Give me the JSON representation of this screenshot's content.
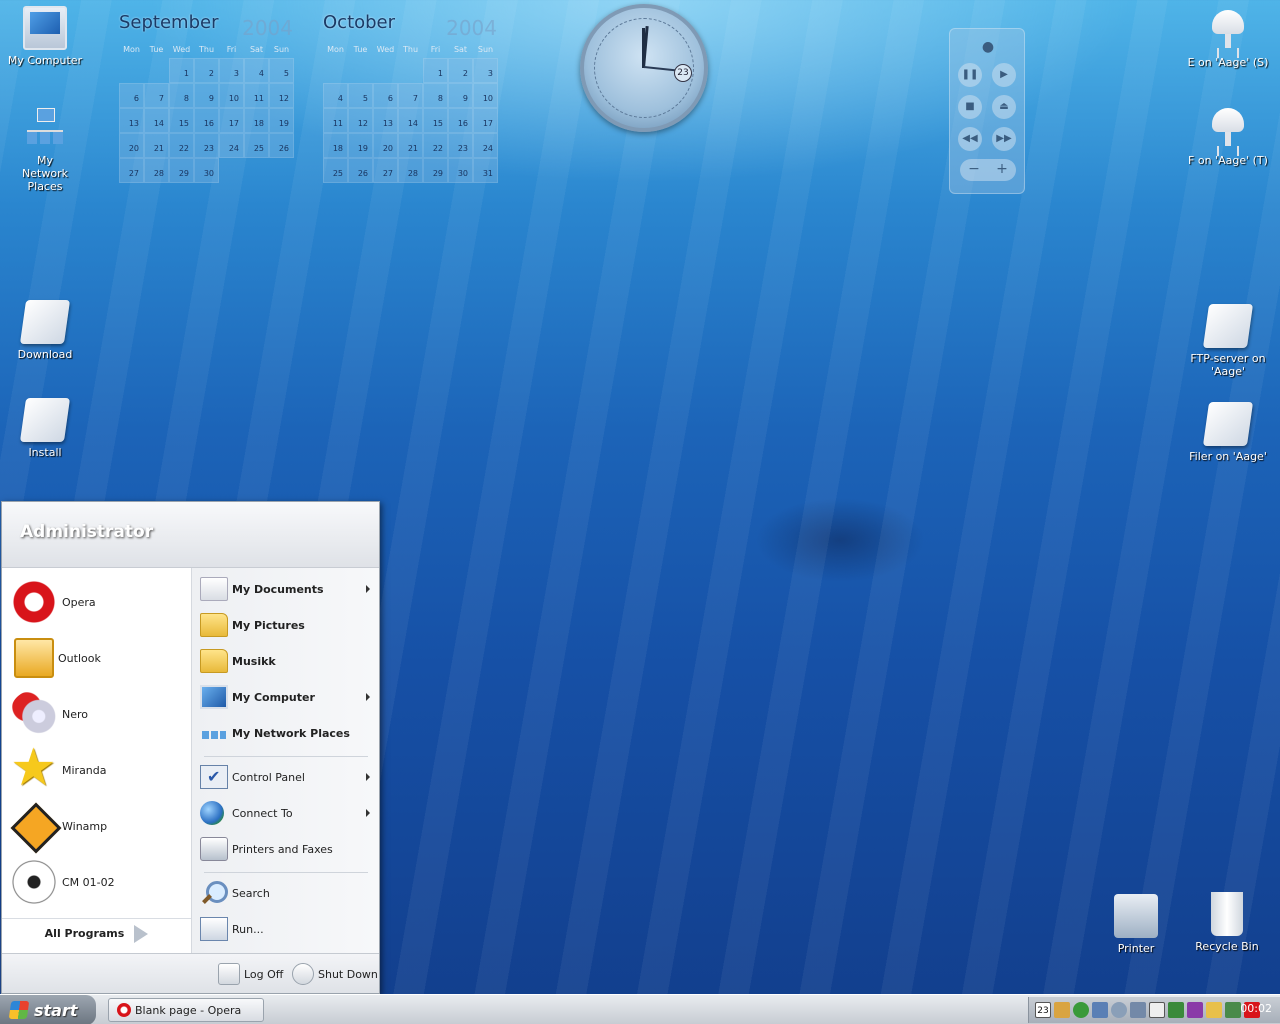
{
  "desktop": {
    "icons_left": [
      {
        "label": "My Computer",
        "icon": "computer-icon"
      },
      {
        "label": "My Network Places",
        "icon": "network-places-icon"
      },
      {
        "label": "Download",
        "icon": "download-icon"
      },
      {
        "label": "Install",
        "icon": "install-icon"
      }
    ],
    "icons_right": [
      {
        "label": "E on 'Aage' (S)",
        "icon": "network-drive-icon"
      },
      {
        "label": "F on 'Aage' (T)",
        "icon": "network-drive-icon"
      },
      {
        "label": "FTP-server  on 'Aage'",
        "icon": "ftp-server-icon"
      },
      {
        "label": "Filer on 'Aage'",
        "icon": "network-share-icon"
      },
      {
        "label": "Printer",
        "icon": "printer-icon"
      },
      {
        "label": "Recycle Bin",
        "icon": "recycle-bin-icon"
      }
    ]
  },
  "calendars": [
    {
      "month": "September",
      "year": "2004",
      "dows": [
        "Mon",
        "Tue",
        "Wed",
        "Thu",
        "Fri",
        "Sat",
        "Sun"
      ],
      "days": [
        "",
        "",
        "1",
        "2",
        "3",
        "4",
        "5",
        "6",
        "7",
        "8",
        "9",
        "10",
        "11",
        "12",
        "13",
        "14",
        "15",
        "16",
        "17",
        "18",
        "19",
        "20",
        "21",
        "22",
        "23",
        "24",
        "25",
        "26",
        "27",
        "28",
        "29",
        "30"
      ]
    },
    {
      "month": "October",
      "year": "2004",
      "dows": [
        "Mon",
        "Tue",
        "Wed",
        "Thu",
        "Fri",
        "Sat",
        "Sun"
      ],
      "days": [
        "",
        "",
        "",
        "",
        "1",
        "2",
        "3",
        "4",
        "5",
        "6",
        "7",
        "8",
        "9",
        "10",
        "11",
        "12",
        "13",
        "14",
        "15",
        "16",
        "17",
        "18",
        "19",
        "20",
        "21",
        "22",
        "23",
        "24",
        "25",
        "26",
        "27",
        "28",
        "29",
        "30",
        "31"
      ]
    }
  ],
  "clock_widget": {
    "date": "23"
  },
  "media_widget": {
    "vol_minus": "−",
    "vol_plus": "+"
  },
  "start_menu": {
    "user": "Administrator",
    "pinned": [
      {
        "label": "Opera",
        "icon": "opera-icon"
      },
      {
        "label": "Outlook",
        "icon": "outlook-icon"
      },
      {
        "label": "Nero",
        "icon": "nero-icon"
      },
      {
        "label": "Miranda",
        "icon": "miranda-icon"
      },
      {
        "label": "Winamp",
        "icon": "winamp-icon"
      },
      {
        "label": "CM 01-02",
        "icon": "soccer-ball-icon"
      }
    ],
    "all_programs": "All Programs",
    "places": [
      {
        "label": "My Documents",
        "icon": "documents-icon",
        "submenu": true
      },
      {
        "label": "My Pictures",
        "icon": "pictures-folder-icon",
        "submenu": false
      },
      {
        "label": "Musikk",
        "icon": "folder-icon",
        "submenu": false
      },
      {
        "label": "My Computer",
        "icon": "computer-icon",
        "submenu": true
      },
      {
        "label": "My Network Places",
        "icon": "network-places-icon",
        "submenu": false
      }
    ],
    "system": [
      {
        "label": "Control Panel",
        "icon": "control-panel-icon",
        "submenu": true
      },
      {
        "label": "Connect To",
        "icon": "globe-icon",
        "submenu": true
      },
      {
        "label": "Printers and Faxes",
        "icon": "printer-icon",
        "submenu": false
      }
    ],
    "tools": [
      {
        "label": "Search",
        "icon": "search-icon"
      },
      {
        "label": "Run...",
        "icon": "run-icon"
      }
    ],
    "log_off": "Log Off",
    "shut_down": "Shut Down"
  },
  "taskbar": {
    "start_label": "start",
    "task": "Blank page - Opera",
    "tray_date": "23",
    "clock": "00:02"
  }
}
